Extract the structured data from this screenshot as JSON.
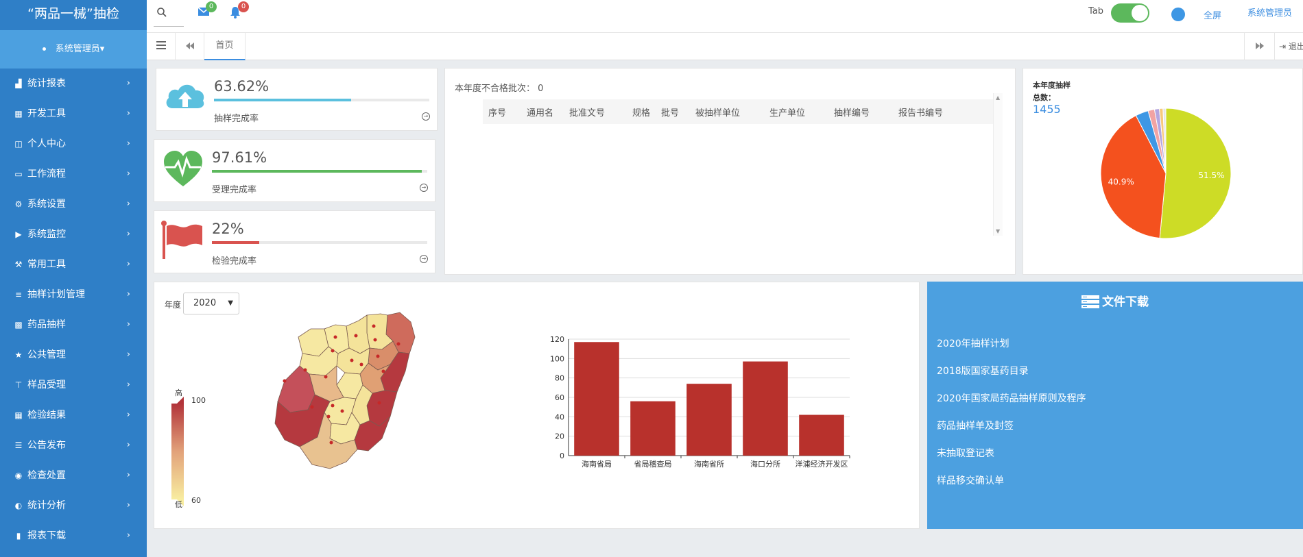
{
  "app": {
    "title": "“两品一械”抽检"
  },
  "user": {
    "name": "系统管理员",
    "caret": "▾"
  },
  "sidebar": {
    "items": [
      {
        "label": "统计报表",
        "icon": "area-chart-icon"
      },
      {
        "label": "开发工具",
        "icon": "grid-icon"
      },
      {
        "label": "个人中心",
        "icon": "columns-icon"
      },
      {
        "label": "工作流程",
        "icon": "desktop-icon"
      },
      {
        "label": "系统设置",
        "icon": "gear-icon"
      },
      {
        "label": "系统监控",
        "icon": "video-camera-icon"
      },
      {
        "label": "常用工具",
        "icon": "wrench-icon"
      },
      {
        "label": "抽样计划管理",
        "icon": "list-icon"
      },
      {
        "label": "药品抽样",
        "icon": "th-large-icon"
      },
      {
        "label": "公共管理",
        "icon": "star-icon"
      },
      {
        "label": "样品受理",
        "icon": "thumb-tack-icon"
      },
      {
        "label": "检验结果",
        "icon": "grid-icon"
      },
      {
        "label": "公告发布",
        "icon": "list-alt-icon"
      },
      {
        "label": "检查处置",
        "icon": "eye-icon"
      },
      {
        "label": "统计分析",
        "icon": "adjust-icon"
      },
      {
        "label": "报表下载",
        "icon": "bar-chart-icon"
      }
    ]
  },
  "header": {
    "mail_count": "0",
    "bell_count": "0",
    "tab_label": "Tab",
    "fullscreen": "全屏",
    "admin": "系统管理员"
  },
  "tabs": {
    "home": "首页",
    "exit": "退出"
  },
  "stats": [
    {
      "value": "63.62%",
      "fraction": 0.6362,
      "label": "抽样完成率",
      "color": "#5bc0de",
      "icon": "cloud-upload-icon"
    },
    {
      "value": "97.61%",
      "fraction": 0.9761,
      "label": "受理完成率",
      "color": "#5cb85c",
      "icon": "heartbeat-icon"
    },
    {
      "value": "22%",
      "fraction": 0.22,
      "label": "检验完成率",
      "color": "#d9534f",
      "icon": "flag-icon"
    }
  ],
  "fail_panel": {
    "title": "本年度不合格批次：",
    "count": "0",
    "columns": [
      "序号",
      "通用名",
      "批准文号",
      "规格",
      "批号",
      "被抽样单位",
      "生产单位",
      "抽样编号",
      "报告书编号"
    ]
  },
  "pie_panel": {
    "title": "本年度抽样",
    "total_label": "总数：",
    "total": "1455"
  },
  "map_panel": {
    "year_label": "年度",
    "year_value": "2020",
    "legend_high": "高",
    "legend_low": "低",
    "legend_max": "100",
    "legend_min": "60"
  },
  "downloads": {
    "title": "文件下载",
    "items": [
      "2020年抽样计划",
      "2018版国家基药目录",
      "2020年国家局药品抽样原则及程序",
      "药品抽样单及封签",
      "未抽取登记表",
      "样品移交确认单"
    ]
  },
  "chart_data": [
    {
      "type": "bar",
      "categories": [
        "海南省局",
        "省局稽查局",
        "海南省所",
        "海口分所",
        "洋浦经济开发区"
      ],
      "values": [
        117,
        56,
        74,
        97,
        42
      ],
      "ylim": [
        0,
        120
      ],
      "yticks": [
        0,
        20,
        40,
        60,
        80,
        100,
        120
      ],
      "color": "#b8312c",
      "grid": true
    },
    {
      "type": "pie",
      "slices": [
        {
          "value": 51.5,
          "color": "#cddc26",
          "label": "51.5%"
        },
        {
          "value": 40.9,
          "color": "#f4511e",
          "label": "40.9%"
        },
        {
          "value": 3.2,
          "color": "#3e97e4",
          "label": ""
        },
        {
          "value": 1.6,
          "color": "#f2a3a3",
          "label": ""
        },
        {
          "value": 1.2,
          "color": "#b5a6e0",
          "label": ""
        },
        {
          "value": 0.9,
          "color": "#f7c97d",
          "label": ""
        },
        {
          "value": 0.7,
          "color": "#e6e6e6",
          "label": ""
        }
      ]
    }
  ]
}
